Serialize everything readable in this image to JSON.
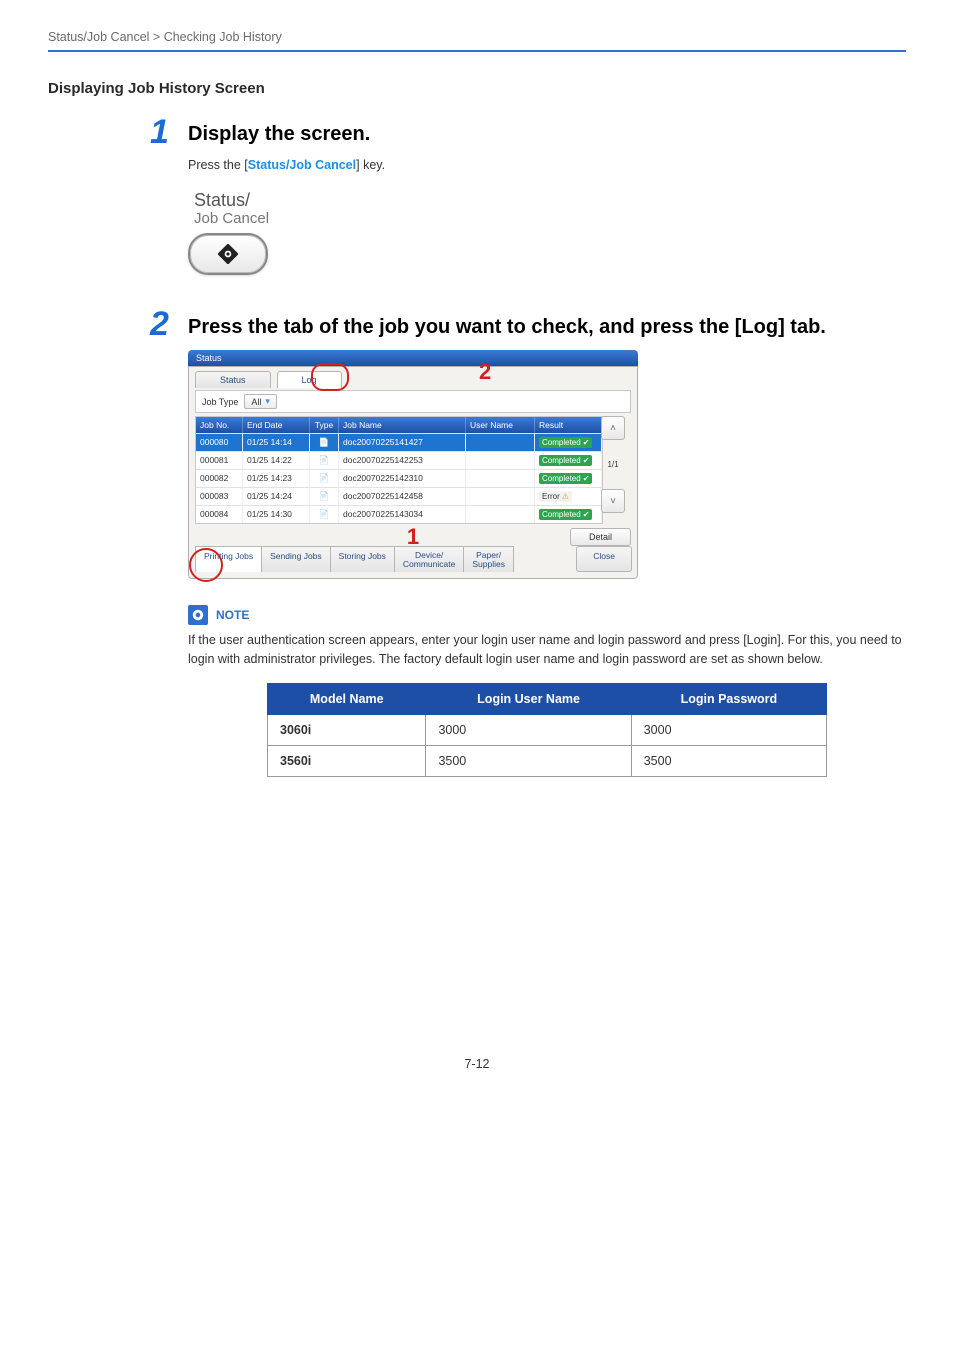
{
  "breadcrumb": "Status/Job Cancel > Checking Job History",
  "section_heading": "Displaying Job History Screen",
  "steps": {
    "one": {
      "num": "1",
      "title": "Display the screen.",
      "text_before": "Press the [",
      "key_name": "Status/Job Cancel",
      "text_after": "] key.",
      "key_graphic_top": "Status/",
      "key_graphic_bottom": "Job Cancel"
    },
    "two": {
      "num": "2",
      "title": "Press the tab of the job you want to check, and press the [Log] tab."
    }
  },
  "panel": {
    "titlebar": "Status",
    "top_tabs": {
      "status": "Status",
      "log": "Log"
    },
    "jobtype_label": "Job Type",
    "jobtype_value": "All",
    "head": {
      "no": "Job No.",
      "date": "End Date",
      "type": "Type",
      "name": "Job Name",
      "user": "User Name",
      "result": "Result"
    },
    "rows": [
      {
        "no": "000080",
        "date": "01/25 14:14",
        "name": "doc20070225141427",
        "user": "",
        "result": "Completed",
        "status": "ok",
        "selected": true
      },
      {
        "no": "000081",
        "date": "01/25 14:22",
        "name": "doc20070225142253",
        "user": "",
        "result": "Completed",
        "status": "ok",
        "selected": false
      },
      {
        "no": "000082",
        "date": "01/25 14:23",
        "name": "doc20070225142310",
        "user": "",
        "result": "Completed",
        "status": "ok",
        "selected": false
      },
      {
        "no": "000083",
        "date": "01/25 14:24",
        "name": "doc20070225142458",
        "user": "",
        "result": "Error",
        "status": "err",
        "selected": false
      },
      {
        "no": "000084",
        "date": "01/25 14:30",
        "name": "doc20070225143034",
        "user": "",
        "result": "Completed",
        "status": "ok",
        "selected": false
      }
    ],
    "pager_count": "1/1",
    "detail_btn": "Detail",
    "bottom_tabs": {
      "printing": "Printing Jobs",
      "sending": "Sending Jobs",
      "storing": "Storing Jobs",
      "device": "Device/\nCommunicate",
      "paper": "Paper/\nSupplies",
      "close": "Close"
    },
    "callout1": "1",
    "callout2": "2"
  },
  "note": {
    "label": "NOTE",
    "body": "If the user authentication screen appears, enter your login user name and login password and press [Login]. For this, you need to login with administrator privileges. The factory default login user name and login password are set as shown below."
  },
  "creds": {
    "headers": {
      "model": "Model Name",
      "user": "Login User Name",
      "pass": "Login Password"
    },
    "rows": [
      {
        "model": "3060i",
        "user": "3000",
        "pass": "3000"
      },
      {
        "model": "3560i",
        "user": "3500",
        "pass": "3500"
      }
    ]
  },
  "page_number": "7-12"
}
